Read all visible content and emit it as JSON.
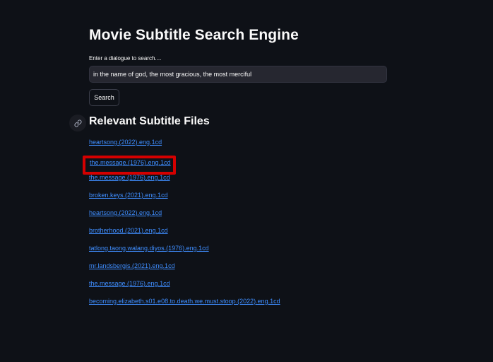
{
  "app": {
    "title": "Movie Subtitle Search Engine"
  },
  "search": {
    "label": "Enter a dialogue to search....",
    "value": "in the name of god, the most gracious, the most merciful",
    "button_label": "Search"
  },
  "results": {
    "heading": "Relevant Subtitle Files",
    "anchor_icon": "link-icon",
    "items": [
      "heartsong.(2022).eng.1cd",
      "the.message.(1976).eng.1cd",
      "the.message.(1976).eng.1cd",
      "broken.keys.(2021).eng.1cd",
      "heartsong.(2022).eng.1cd",
      "brotherhood.(2021).eng.1cd",
      "tatlong.taong.walang.diyos.(1976).eng.1cd",
      "mr.landsbergis.(2021).eng.1cd",
      "the.message.(1976).eng.1cd",
      "becoming.elizabeth.s01.e08.to.death.we.must.stoop.(2022).eng.1cd"
    ],
    "highlighted_index": 1
  },
  "colors": {
    "background": "#0e1117",
    "input_background": "#262730",
    "link": "#3f8eff",
    "highlight": "#d40000"
  }
}
